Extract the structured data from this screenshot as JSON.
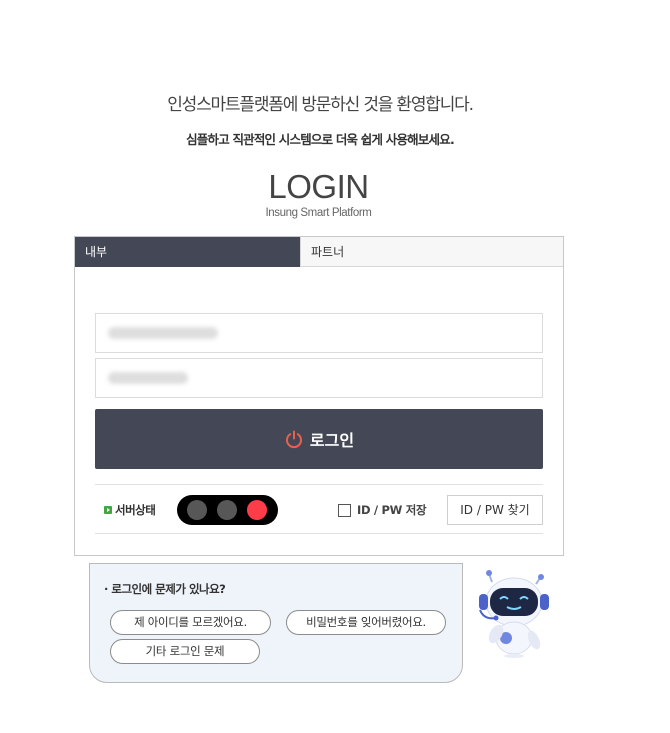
{
  "header": {
    "welcome": "인성스마트플랫폼에 방문하신 것을 환영합니다.",
    "subtitle": "심플하고 직관적인 시스템으로 더욱 쉽게 사용해보세요.",
    "login_title": "LOGIN",
    "login_subtitle": "Insung Smart Platform"
  },
  "tabs": [
    {
      "label": "내부",
      "active": true
    },
    {
      "label": "파트너",
      "active": false
    }
  ],
  "login_button": {
    "label": "로그인",
    "icon": "power-icon",
    "icon_color": "#e9604f"
  },
  "server_status": {
    "label": "서버상태",
    "lights": [
      "#575757",
      "#575757",
      "#ff3d4a"
    ]
  },
  "save_id_pw": {
    "label": "ID / PW 저장",
    "checked": false
  },
  "find_button": {
    "label": "ID / PW 찾기"
  },
  "help": {
    "title": "· 로그인에 문제가 있나요?",
    "buttons": [
      "제 아이디를 모르겠어요.",
      "비밀번호를 잊어버렸어요.",
      "기타 로그인 문제"
    ]
  },
  "colors": {
    "accent_dark": "#444755",
    "status_red": "#ff3d4a",
    "status_green": "#3fa845"
  }
}
